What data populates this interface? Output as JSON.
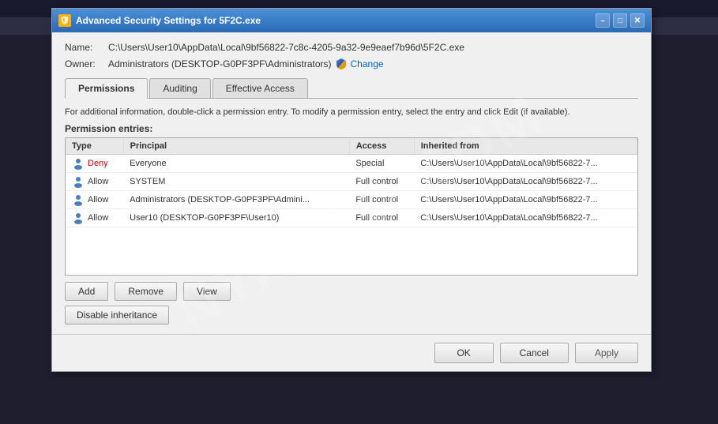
{
  "window": {
    "title": "Advanced Security Settings for 5F2C.exe",
    "title_icon": "🔒"
  },
  "info": {
    "name_label": "Name:",
    "name_value": "C:\\Users\\User10\\AppData\\Local\\9bf56822-7c8c-4205-9a32-9e9eaef7b96d\\5F2C.exe",
    "owner_label": "Owner:",
    "owner_value": "Administrators (DESKTOP-G0PF3PF\\Administrators)",
    "change_link": "Change"
  },
  "tabs": [
    {
      "id": "permissions",
      "label": "Permissions",
      "active": true
    },
    {
      "id": "auditing",
      "label": "Auditing",
      "active": false
    },
    {
      "id": "effective-access",
      "label": "Effective Access",
      "active": false
    }
  ],
  "instructions": "For additional information, double-click a permission entry. To modify a permission entry, select the entry and click Edit (if available).",
  "section_label": "Permission entries:",
  "table": {
    "columns": [
      {
        "id": "type",
        "label": "Type"
      },
      {
        "id": "principal",
        "label": "Principal"
      },
      {
        "id": "access",
        "label": "Access"
      },
      {
        "id": "inherited_from",
        "label": "Inherited from"
      }
    ],
    "rows": [
      {
        "type": "Deny",
        "principal": "Everyone",
        "access": "Special",
        "inherited_from": "C:\\Users\\User10\\AppData\\Local\\9bf56822-7...",
        "is_inherited": true,
        "selected": false
      },
      {
        "type": "Allow",
        "principal": "SYSTEM",
        "access": "Full control",
        "inherited_from": "C:\\Users\\User10\\AppData\\Local\\9bf56822-7...",
        "is_inherited": true,
        "selected": false
      },
      {
        "type": "Allow",
        "principal": "Administrators (DESKTOP-G0PF3PF\\Admini...",
        "access": "Full control",
        "inherited_from": "C:\\Users\\User10\\AppData\\Local\\9bf56822-7...",
        "is_inherited": true,
        "selected": false
      },
      {
        "type": "Allow",
        "principal": "User10 (DESKTOP-G0PF3PF\\User10)",
        "access": "Full control",
        "inherited_from": "C:\\Users\\User10\\AppData\\Local\\9bf56822-7...",
        "is_inherited": true,
        "selected": false
      }
    ]
  },
  "buttons": {
    "add": "Add",
    "remove": "Remove",
    "view": "View",
    "disable_inheritance": "Disable inheritance"
  },
  "footer": {
    "ok": "OK",
    "cancel": "Cancel",
    "apply": "Apply"
  },
  "watermark": "NYANTD.COM"
}
